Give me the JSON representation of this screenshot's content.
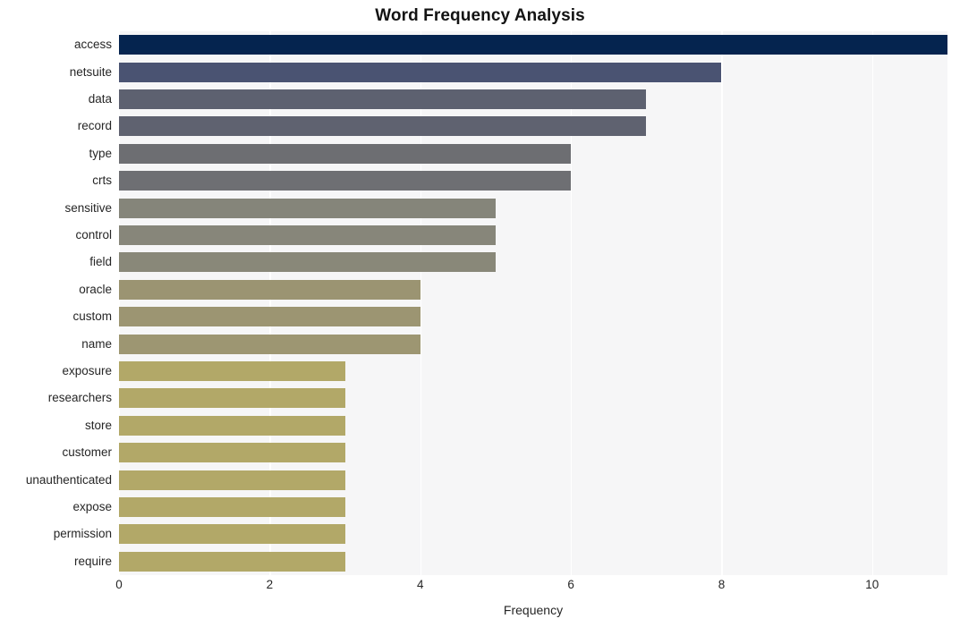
{
  "chart_data": {
    "type": "bar",
    "orientation": "horizontal",
    "title": "Word Frequency Analysis",
    "xlabel": "Frequency",
    "ylabel": "",
    "xlim": [
      0,
      11
    ],
    "ylim": null,
    "grid": "vertical-white-gridlines",
    "legend": null,
    "plot_background": "#f6f6f7",
    "categories": [
      "access",
      "netsuite",
      "data",
      "record",
      "type",
      "crts",
      "sensitive",
      "control",
      "field",
      "oracle",
      "custom",
      "name",
      "exposure",
      "researchers",
      "store",
      "customer",
      "unauthenticated",
      "expose",
      "permission",
      "require"
    ],
    "values": [
      11,
      8,
      7,
      7,
      6,
      6,
      5,
      5,
      5,
      4,
      4,
      4,
      3,
      3,
      3,
      3,
      3,
      3,
      3,
      3
    ],
    "bar_colors": [
      "#05244f",
      "#4a5372",
      "#5d6170",
      "#5f6270",
      "#6d6e72",
      "#6e6f73",
      "#85857a",
      "#87867a",
      "#898879",
      "#9b9472",
      "#9c9572",
      "#9d9672",
      "#b2a868",
      "#b2a868",
      "#b2a868",
      "#b2a868",
      "#b2a868",
      "#b2a868",
      "#b2a868",
      "#b2a868"
    ],
    "xticks": [
      "0",
      "2",
      "4",
      "6",
      "8",
      "10"
    ],
    "xtick_values": [
      0,
      2,
      4,
      6,
      8,
      10
    ]
  }
}
